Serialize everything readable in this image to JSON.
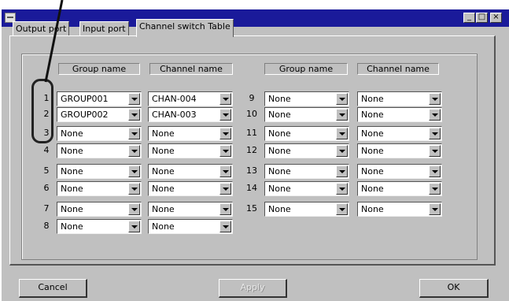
{
  "window": {
    "title": "",
    "buttons": [
      "minimize",
      "maximize",
      "close"
    ]
  },
  "tabs": [
    {
      "label": "Output port",
      "active": false
    },
    {
      "label": "Input port",
      "active": false
    },
    {
      "label": "Channel switch Table",
      "active": true
    }
  ],
  "headers": {
    "group": "Group name",
    "channel": "Channel name"
  },
  "rows": [
    {
      "num": "1",
      "group": "GROUP001",
      "channel": "CHAN-004"
    },
    {
      "num": "2",
      "group": "GROUP002",
      "channel": "CHAN-003"
    },
    {
      "num": "3",
      "group": "None",
      "channel": "None"
    },
    {
      "num": "4",
      "group": "None",
      "channel": "None"
    },
    {
      "num": "5",
      "group": "None",
      "channel": "None"
    },
    {
      "num": "6",
      "group": "None",
      "channel": "None"
    },
    {
      "num": "7",
      "group": "None",
      "channel": "None"
    },
    {
      "num": "8",
      "group": "None",
      "channel": "None"
    },
    {
      "num": "9",
      "group": "None",
      "channel": "None"
    },
    {
      "num": "10",
      "group": "None",
      "channel": "None"
    },
    {
      "num": "11",
      "group": "None",
      "channel": "None"
    },
    {
      "num": "12",
      "group": "None",
      "channel": "None"
    },
    {
      "num": "13",
      "group": "None",
      "channel": "None"
    },
    {
      "num": "14",
      "group": "None",
      "channel": "None"
    },
    {
      "num": "15",
      "group": "None",
      "channel": "None"
    }
  ],
  "buttons": {
    "cancel": "Cancel",
    "apply": "Apply",
    "ok": "OK"
  },
  "colors": {
    "titlebar": "#1a1a9a",
    "face": "#c0c0c0"
  }
}
